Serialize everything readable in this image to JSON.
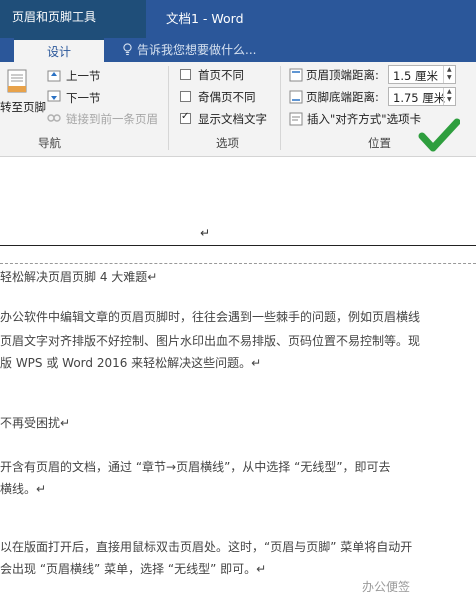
{
  "titlebar": {
    "context_group": "页眉和页脚工具",
    "window_title": "文档1 - Word"
  },
  "tabs": {
    "active": "设计",
    "tell_me": "告诉我您想要做什么..."
  },
  "ribbon": {
    "nav_group": {
      "goto_footer": "转至页脚",
      "prev_section": "上一节",
      "next_section": "下一节",
      "link_prev": "链接到前一条页眉",
      "label": "导航"
    },
    "options_group": {
      "first_page": "首页不同",
      "odd_even": "奇偶页不同",
      "show_text": "显示文档文字",
      "label": "选项"
    },
    "position_group": {
      "header_top_label": "页眉顶端距离:",
      "header_top_value": "1.5 厘米",
      "footer_bottom_label": "页脚底端距离:",
      "footer_bottom_value": "1.75 厘米",
      "insert_tab": "插入\"对齐方式\"选项卡",
      "label": "位置"
    },
    "colors": {
      "accent": "#2b579a",
      "check": "#2e9e3e"
    }
  },
  "document": {
    "cursor_mark": "↵",
    "lines": [
      "轻松解决页眉页脚 4 大难题↵",
      "办公软件中编辑文章的页眉页脚时，往往会遇到一些棘手的问题，例如页眉横线",
      "页眉文字对齐排版不好控制、图片水印出血不易排版、页码位置不易控制等。现",
      "版 WPS 或 Word 2016 来轻松解决这些问题。↵",
      "不再受困扰↵",
      "开含有页眉的文档，通过 “章节→页眉横线”，从中选择 “无线型”，即可去",
      "横线。↵",
      "以在版面打开后，直接用鼠标双击页眉处。这时，“页眉与页脚” 菜单将自动开",
      "会出现 “页眉横线” 菜单，选择 “无线型” 即可。↵"
    ]
  },
  "watermark": "办公便签"
}
